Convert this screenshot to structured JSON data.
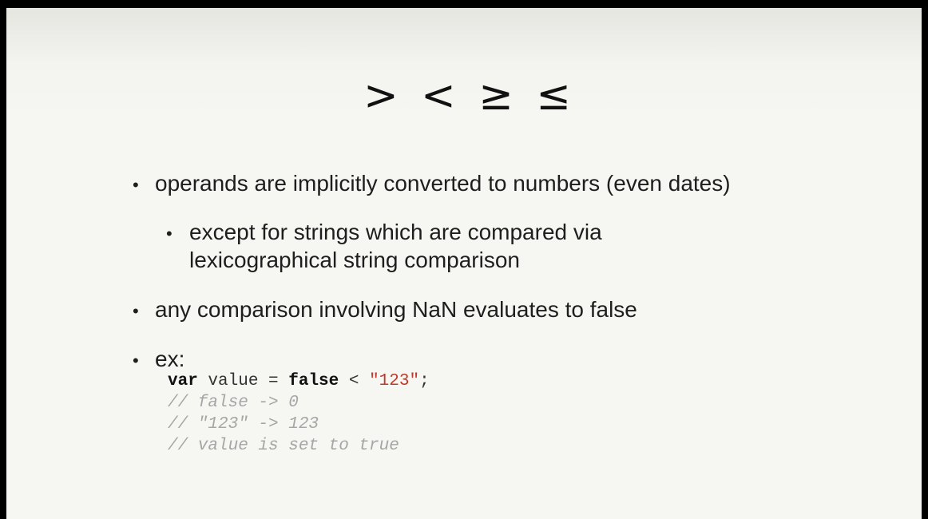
{
  "slide": {
    "title": "> < ≥ ≤",
    "bullets": [
      {
        "text": "operands are implicitly converted to numbers (even dates)"
      },
      {
        "text_line1": "except for strings which are compared via",
        "text_line2": "lexicographical string comparison"
      },
      {
        "text": "any comparison involving NaN evaluates to false"
      },
      {
        "text": "ex:"
      }
    ],
    "code": {
      "line1": {
        "kw_var": "var",
        "ident": " value = ",
        "kw_false": "false",
        "op": " < ",
        "string": "\"123\"",
        "end": ";"
      },
      "comments": [
        "// false -> 0",
        "// \"123\" -> 123",
        "// value is set to true"
      ]
    },
    "colors": {
      "string_literal": "#c0392b",
      "comment": "#a6a6a6",
      "background": "#f6f6f2"
    }
  }
}
